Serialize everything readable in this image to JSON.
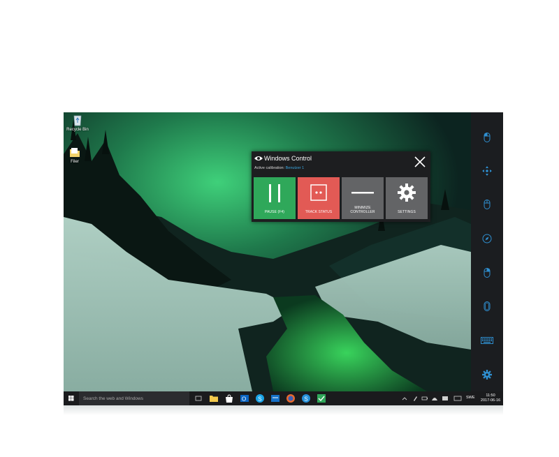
{
  "desktop": {
    "icons": [
      {
        "label": "Recycle Bin",
        "icon": "recycle-bin-icon"
      },
      {
        "label": "Filer",
        "icon": "folder-icon"
      }
    ]
  },
  "control_panel": {
    "title": "Windows Control",
    "calibration_label": "Active calibration:",
    "calibration_profile": "Benutzer 1",
    "buttons": {
      "pause": {
        "label": "PAUSE (F4)",
        "color": "#2fa85a"
      },
      "track_status": {
        "label": "TRACK STATUS",
        "color": "#e25a55"
      },
      "minimize": {
        "label_line1": "MINIMIZE",
        "label_line2": "CONTROLLER",
        "color": "#636466"
      },
      "settings": {
        "label": "SETTINGS",
        "color": "#636466"
      }
    }
  },
  "sidebar": {
    "accent": "#2f8fd0",
    "items": [
      {
        "icon": "mouse-click-icon"
      },
      {
        "icon": "move-arrows-icon"
      },
      {
        "icon": "mouse-left-icon"
      },
      {
        "icon": "compass-icon"
      },
      {
        "icon": "mouse-right-icon"
      },
      {
        "icon": "mouse-double-click-icon"
      },
      {
        "icon": "keyboard-icon"
      },
      {
        "icon": "settings-gear-icon"
      }
    ]
  },
  "taskbar": {
    "search_placeholder": "Search the web and Windows",
    "language": "SWE",
    "time": "11:50",
    "date": "2017-06-16"
  }
}
